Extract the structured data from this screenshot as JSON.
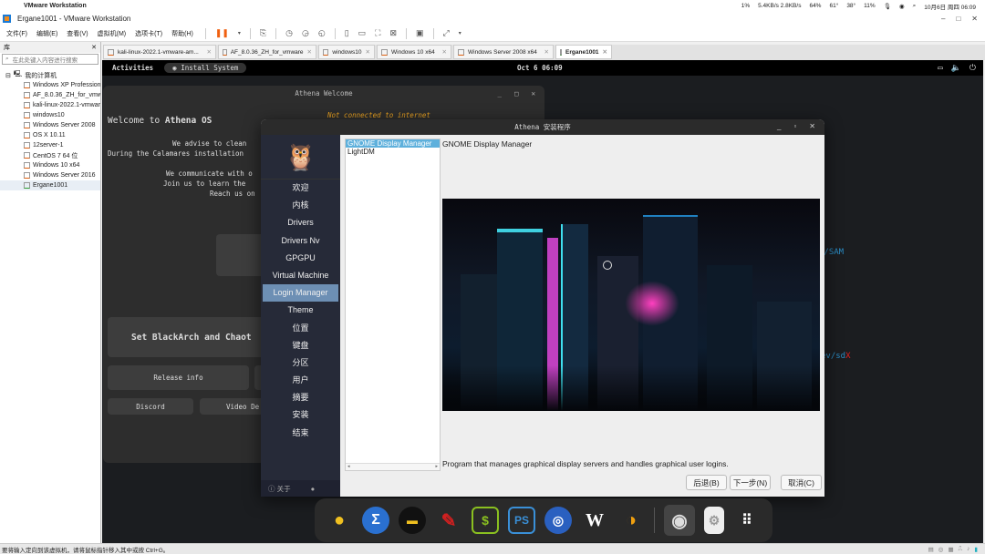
{
  "mac_menubar": {
    "app": "VMware Workstation",
    "status": [
      "1%",
      "5.4KB/s 2.8KB/s",
      "64%",
      "61°",
      "38°",
      "11%"
    ],
    "datetime": "10月6日 周四 06:09"
  },
  "window": {
    "title": "Ergane1001 - VMware Workstation"
  },
  "menu": [
    "文件(F)",
    "编辑(E)",
    "查看(V)",
    "虚拟机(M)",
    "选项卡(T)",
    "帮助(H)"
  ],
  "library": {
    "title": "库",
    "search_placeholder": "在此处键入内容进行搜索",
    "root": "我的计算机",
    "items": [
      "Windows XP Professional",
      "AF_8.0.36_ZH_for_vmware",
      "kali-linux-2022.1-vmware",
      "windows10",
      "Windows Server 2008",
      "OS X 10.11",
      "12server-1",
      "CentOS 7 64 位",
      "Windows 10 x64",
      "Windows Server 2016",
      "Ergane1001"
    ]
  },
  "tabs": [
    {
      "label": "kali-linux-2022.1-vmware-am..."
    },
    {
      "label": "AF_8.0.36_ZH_for_vmware"
    },
    {
      "label": "windows10"
    },
    {
      "label": "Windows 10 x64"
    },
    {
      "label": "Windows Server 2008 x64"
    },
    {
      "label": "Ergane1001",
      "active": true
    }
  ],
  "gnome": {
    "activities": "Activities",
    "install": "Install System",
    "clock": "Oct 6 06:09"
  },
  "terminal": {
    "line1": "g/SAM",
    "line2a": "ev/sd",
    "line2b": "X"
  },
  "welcome": {
    "title": "Athena Welcome",
    "net": "Not connected to internet",
    "heading_pre": "Welcome to ",
    "heading_bold": "Athena OS",
    "lines": [
      "We advise to clean",
      "During the Calamares installation",
      "We communicate with o",
      "Join us to learn the",
      "Reach us on"
    ],
    "set_btn": "Set BlackArch and Chaot",
    "release": "Release info",
    "discord": "Discord",
    "video": "Video De"
  },
  "installer": {
    "title": "Athena 安装程序",
    "steps": [
      "欢迎",
      "内核",
      "Drivers",
      "Drivers Nv",
      "GPGPU",
      "Virtual Machine",
      "Login Manager",
      "Theme",
      "位置",
      "键盘",
      "分区",
      "用户",
      "摘要",
      "安装",
      "结束"
    ],
    "selected_step": "Login Manager",
    "about": "关于",
    "options": [
      "GNOME Display Manager",
      "LightDM"
    ],
    "selected_name": "GNOME Display Manager",
    "description": "Program that manages graphical display servers and handles graphical user logins.",
    "back": "后退(B)",
    "next": "下一步(N)",
    "cancel": "取消(C)"
  },
  "dock": [
    "kiwi",
    "sigma",
    "ninja",
    "syringe",
    "terminal-dollar",
    "powershell",
    "fingerprint",
    "wikipedia",
    "eye",
    "disk-installer",
    "settings",
    "app-grid"
  ],
  "statusbar": {
    "text": "要将输入定向到该虚拟机，请将鼠标指针移入其中或按 Ctrl+G。"
  },
  "colors": {
    "accent": "#5eb0dc",
    "sidebar": "#262a38",
    "selected_step": "#6d8fb4",
    "warning": "#e8a020"
  }
}
